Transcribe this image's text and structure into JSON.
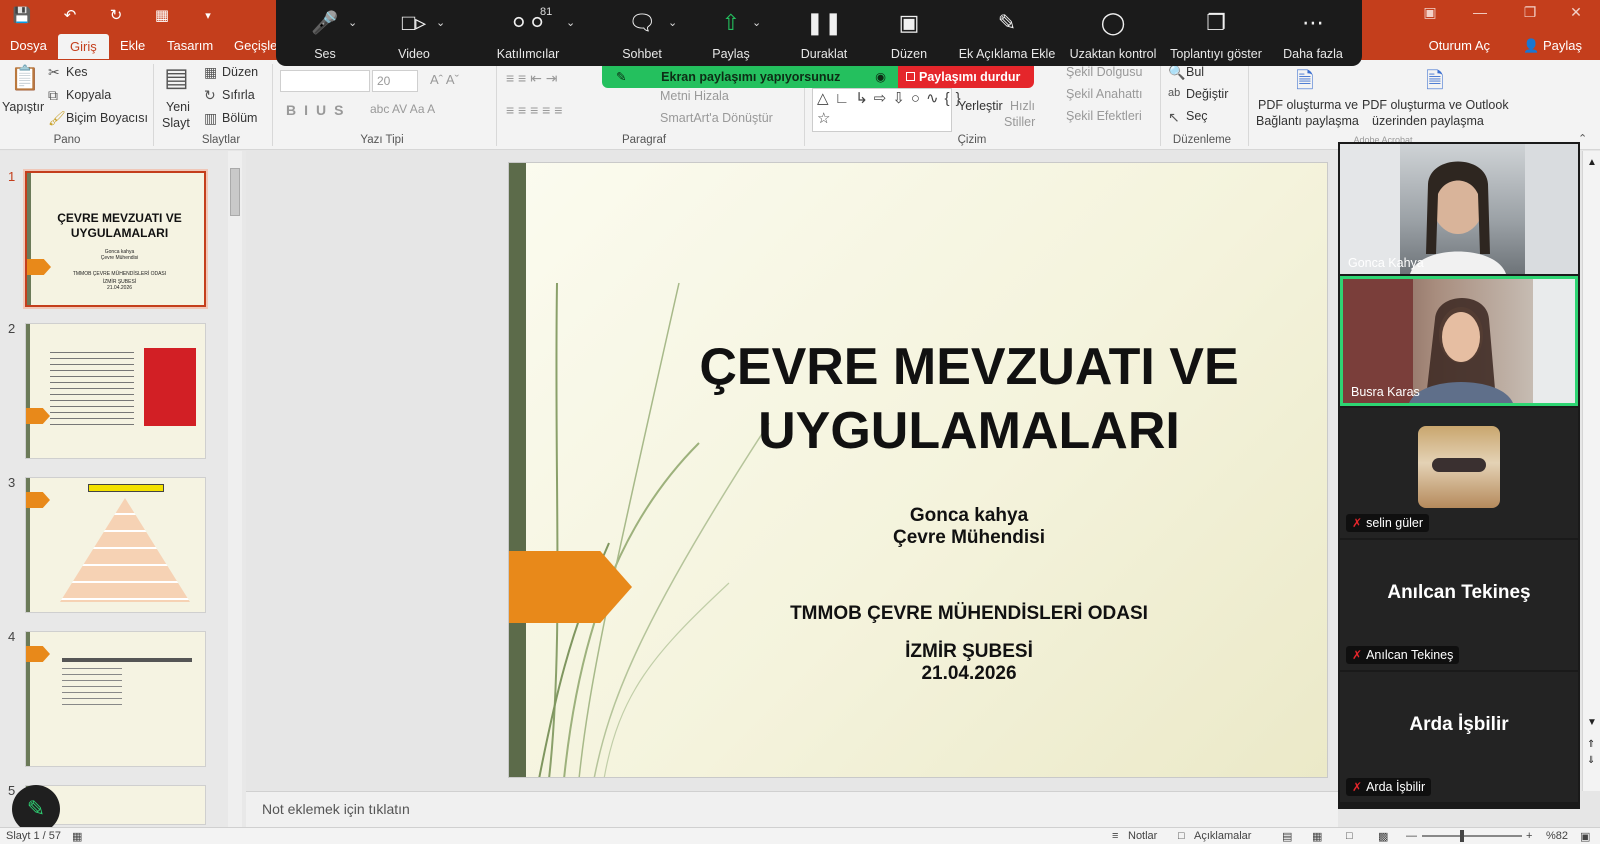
{
  "titlebar": {
    "save_icon": "save-icon",
    "undo_icon": "undo-icon",
    "redo_icon": "redo-icon",
    "present_icon": "presentation-icon"
  },
  "menu": {
    "tabs": [
      "Dosya",
      "Giriş",
      "Ekle",
      "Tasarım",
      "Geçişler"
    ],
    "active": "Giriş",
    "signin": "Oturum Aç",
    "share": "Paylaş"
  },
  "ribbon": {
    "pano": {
      "paste": "Yapıştır",
      "cut": "Kes",
      "copy": "Kopyala",
      "format_painter": "Biçim Boyacısı",
      "group": "Pano"
    },
    "slaytlar": {
      "new_slide_1": "Yeni",
      "new_slide_2": "Slayt",
      "layout": "Düzen",
      "reset": "Sıfırla",
      "section": "Bölüm",
      "group": "Slaytlar"
    },
    "yazi_tipi": {
      "font_size": "20",
      "group": "Yazı Tipi"
    },
    "paragraf": {
      "align_text": "Metni Hizala",
      "smartart": "SmartArt'a Dönüştür",
      "group": "Paragraf"
    },
    "cizim": {
      "arrange_1": "Yerleştir",
      "quick_styles_1": "Hızlı",
      "quick_styles_2": "Stiller",
      "shape_fill": "Şekil Dolgusu",
      "shape_outline": "Şekil Anahattı",
      "shape_effects": "Şekil Efektleri",
      "group": "Çizim"
    },
    "duzenleme": {
      "find": "Bul",
      "replace": "Değiştir",
      "select": "Seç",
      "group": "Düzenleme"
    },
    "adobe": {
      "pdf1_1": "PDF oluşturma ve",
      "pdf1_2": "Bağlantı paylaşma",
      "pdf2_1": "PDF oluşturma ve Outlook",
      "pdf2_2": "üzerinden paylaşma",
      "group": "Adobe Acrobat"
    }
  },
  "zoom": {
    "items": [
      {
        "label": "Ses",
        "icon": "microphone-icon"
      },
      {
        "label": "Video",
        "icon": "video-camera-icon"
      },
      {
        "label": "Katılımcılar",
        "icon": "participants-icon",
        "count": "81"
      },
      {
        "label": "Sohbet",
        "icon": "chat-icon"
      },
      {
        "label": "Paylaş",
        "icon": "share-screen-icon"
      },
      {
        "label": "Duraklat",
        "icon": "pause-icon"
      },
      {
        "label": "Düzen",
        "icon": "layout-icon"
      },
      {
        "label": "Ek Açıklama Ekle",
        "icon": "annotate-icon"
      },
      {
        "label": "Uzaktan kontrol",
        "icon": "mouse-icon"
      },
      {
        "label": "Toplantıyı göster",
        "icon": "show-meeting-icon"
      },
      {
        "label": "Daha fazla",
        "icon": "more-icon"
      }
    ],
    "sharing_banner": "Ekran paylaşımı yapıyorsunuz",
    "stop_share": "Paylaşımı durdur"
  },
  "thumbnails": [
    {
      "num": "1",
      "title": "ÇEVRE MEVZUATI VE UYGULAMALARI"
    },
    {
      "num": "2"
    },
    {
      "num": "3"
    },
    {
      "num": "4"
    },
    {
      "num": "5"
    }
  ],
  "slide": {
    "title": "ÇEVRE MEVZUATI VE UYGULAMALARI",
    "presenter": "Gonca kahya",
    "role": "Çevre Mühendisi",
    "org": "TMMOB ÇEVRE MÜHENDİSLERİ ODASI",
    "branch": "İZMİR ŞUBESİ",
    "date": "21.04.2026"
  },
  "notes_placeholder": "Not eklemek için tıklatın",
  "participants": [
    {
      "name": "Gonca Kahya",
      "type": "video"
    },
    {
      "name": "Busra Karas",
      "type": "video",
      "active": true
    },
    {
      "name": "selin güler",
      "type": "avatar",
      "muted": true
    },
    {
      "name": "Anılcan Tekineş",
      "type": "name",
      "muted": true
    },
    {
      "name": "Arda İşbilir",
      "type": "name",
      "muted": true
    }
  ],
  "status": {
    "slide_counter": "Slayt 1 / 57",
    "notes": "Notlar",
    "comments": "Açıklamalar",
    "zoom": "%82"
  },
  "colors": {
    "accent": "#c43e1c",
    "zoom_toolbar": "#1b1b1b",
    "share_green": "#24c05e",
    "stop_red": "#e5262b",
    "slide_orange": "#e8891a"
  }
}
